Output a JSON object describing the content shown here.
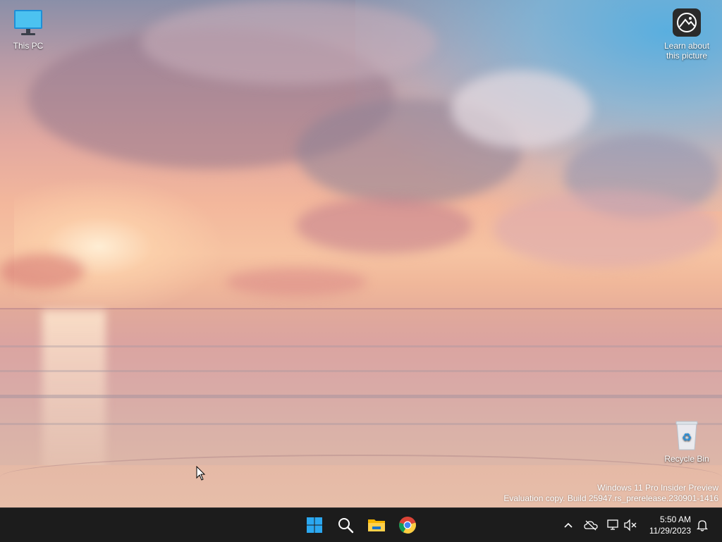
{
  "desktop": {
    "icons": [
      {
        "label": "This PC",
        "icon": "monitor-icon"
      },
      {
        "label": "Learn about this picture",
        "icon": "learn-about-picture-icon"
      },
      {
        "label": "Recycle Bin",
        "icon": "recycle-bin-icon"
      }
    ],
    "watermark": {
      "line1": "Windows 11 Pro Insider Preview",
      "line2": "Evaluation copy. Build 25947.rs_prerelease.230901-1416"
    }
  },
  "taskbar": {
    "apps": [
      {
        "name": "Start",
        "icon": "windows-logo-icon"
      },
      {
        "name": "Search",
        "icon": "search-icon"
      },
      {
        "name": "File Explorer",
        "icon": "folder-icon"
      },
      {
        "name": "Google Chrome",
        "icon": "chrome-icon"
      }
    ],
    "tray": {
      "icons": [
        "chevron-up-icon",
        "onedrive-offline-icon",
        "network-icon",
        "volume-muted-icon",
        "notification-bell-icon"
      ],
      "time": "5:50 AM",
      "date": "11/29/2023"
    }
  },
  "colors": {
    "taskbar_bg": "#1c1c1c",
    "windows_blue": "#2ba8f0"
  }
}
